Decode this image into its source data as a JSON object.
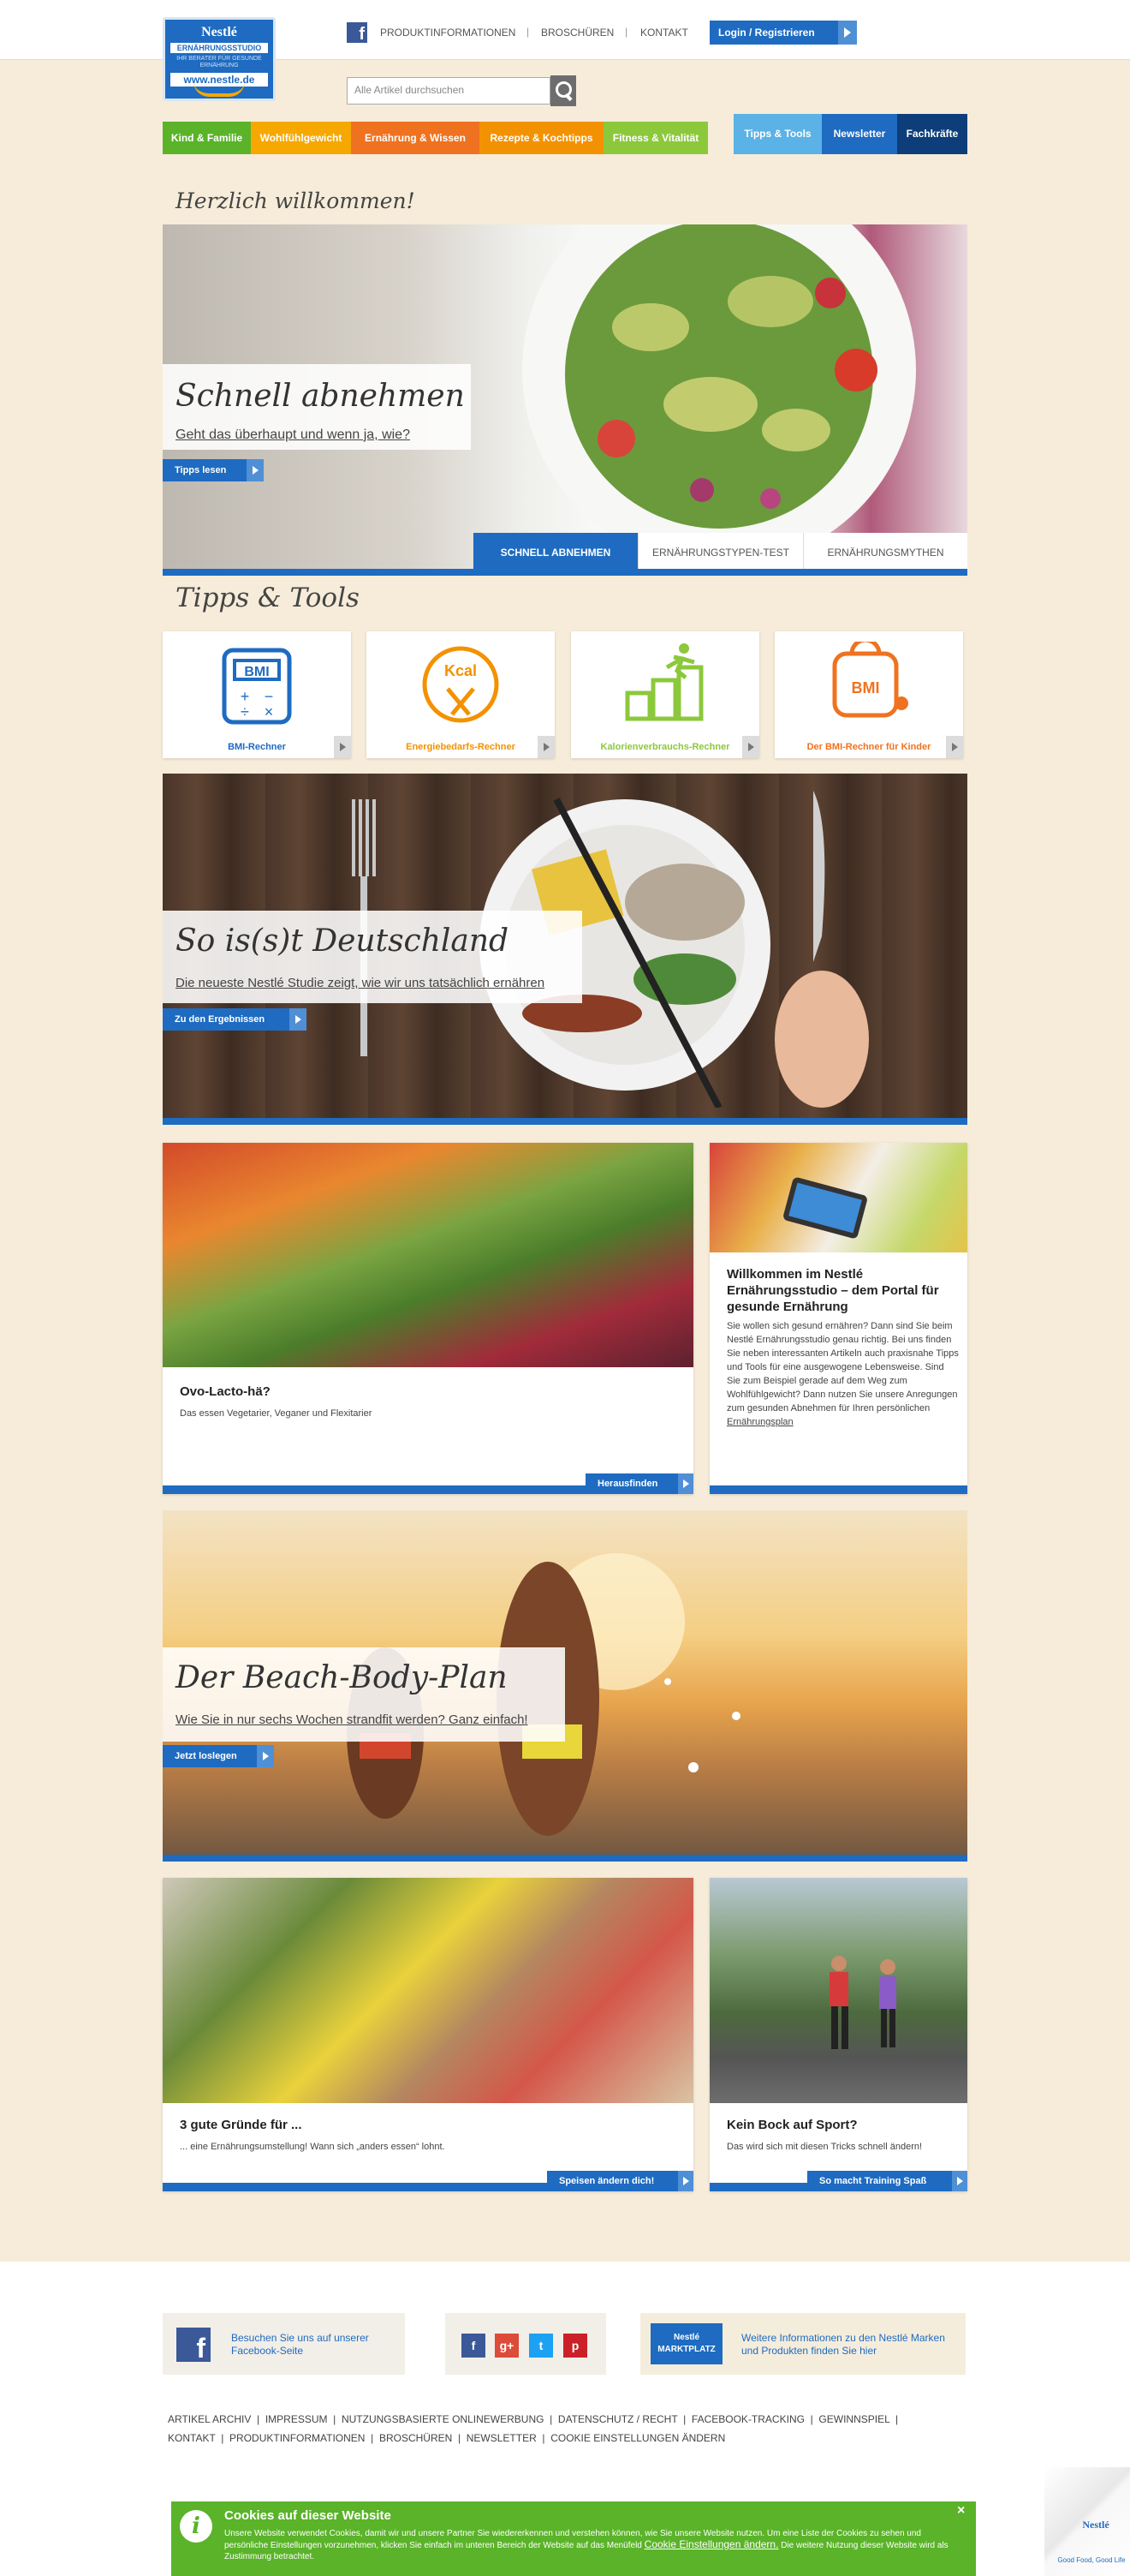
{
  "logo": {
    "brand": "Nestlé",
    "studio": "ERNÄHRUNGSSTUDIO",
    "tagline": "IHR BERATER FÜR GESUNDE ERNÄHRUNG",
    "url": "www.nestle.de"
  },
  "topnav": {
    "links": [
      "PRODUKTINFORMATIONEN",
      "BROSCHÜREN",
      "KONTAKT"
    ],
    "login": "Login / Registrieren",
    "fb": "f"
  },
  "search": {
    "placeholder": "Alle Artikel durchsuchen"
  },
  "mainnav": {
    "items": [
      {
        "label": "Kind & Familie",
        "color": "#5ab329"
      },
      {
        "label": "Wohlfühlgewicht",
        "color": "#f6a800"
      },
      {
        "label": "Ernährung & Wissen",
        "color": "#ef7220"
      },
      {
        "label": "Rezepte & Kochtipps",
        "color": "#f39200"
      },
      {
        "label": "Fitness & Vitalität",
        "color": "#8cc83c"
      }
    ],
    "right": [
      {
        "label": "Tipps & Tools",
        "color": "#5ab2e6"
      },
      {
        "label": "Newsletter",
        "color": "#1e6bc1"
      },
      {
        "label": "Fachkräfte",
        "color": "#0d3e7a"
      }
    ]
  },
  "welcome": "Herzlich willkommen!",
  "hero1": {
    "title": "Schnell abnehmen",
    "subtitle": "Geht das überhaupt und wenn ja, wie?",
    "cta": "Tipps lesen",
    "tabs": [
      "SCHNELL ABNEHMEN",
      "ERNÄHRUNGSTYPEN-TEST",
      "ERNÄHRUNGSMYTHEN"
    ]
  },
  "tipps": {
    "title": "Tipps & Tools",
    "tools": [
      {
        "label": "BMI-Rechner",
        "color": "#1e6bc1",
        "icon": "bmi-calculator-icon"
      },
      {
        "label": "Energiebedarfs-Rechner",
        "color": "#f39200",
        "icon": "kcal-plate-icon"
      },
      {
        "label": "Kalorienverbrauchs-Rechner",
        "color": "#8cc83c",
        "icon": "stairs-runner-icon"
      },
      {
        "label": "Der BMI-Rechner für Kinder",
        "color": "#ef7220",
        "icon": "bmi-scale-icon"
      }
    ]
  },
  "hero2": {
    "title": "So is(s)t Deutschland",
    "subtitle": "Die neueste Nestlé Studie zeigt, wie wir uns tatsächlich ernähren",
    "cta": "Zu den Ergebnissen"
  },
  "card1": {
    "title": "Ovo-Lacto-hä?",
    "text": "Das essen Vegetarier, Veganer und Flexitarier",
    "cta": "Herausfinden"
  },
  "portal": {
    "title": "Willkommen im Nestlé Ernährungsstudio – dem Portal für gesunde Ernährung",
    "text": "Sie wollen sich gesund ernähren? Dann sind Sie beim Nestlé Ernährungsstudio genau richtig. Bei uns finden Sie neben interessanten Artikeln auch praxisnahe Tipps und Tools für eine ausgewogene Lebensweise. Sind Sie zum Beispiel gerade auf dem Weg zum Wohlfühlgewicht? Dann nutzen Sie unsere Anregungen zum gesunden Abnehmen für Ihren persönlichen",
    "link": "Ernährungsplan"
  },
  "hero3": {
    "title": "Der Beach-Body-Plan",
    "subtitle": "Wie Sie in nur sechs Wochen strandfit werden? Ganz einfach!",
    "cta": "Jetzt loslegen"
  },
  "card2": {
    "title": "3 gute Gründe für ...",
    "text": "... eine Ernährungsumstellung! Wann sich „anders essen“ lohnt.",
    "cta": "Speisen ändern dich!"
  },
  "card3": {
    "title": "Kein Bock auf Sport?",
    "text": "Das wird sich mit diesen Tricks schnell ändern!",
    "cta": "So macht Training Spaß"
  },
  "footer": {
    "facebook": "Besuchen Sie uns auf unserer Facebook-Seite",
    "social": [
      "f",
      "g+",
      "t",
      "p"
    ],
    "marktplatz_logo": "Nestlé MARKTPLATZ",
    "marktplatz": "Weitere Informationen zu den Nestlé Marken und Produkten finden Sie hier",
    "links1": [
      "ARTIKEL ARCHIV",
      "IMPRESSUM",
      "NUTZUNGSBASIERTE ONLINEWERBUNG",
      "DATENSCHUTZ / RECHT",
      "FACEBOOK-TRACKING",
      "GEWINNSPIEL"
    ],
    "links2": [
      "KONTAKT",
      "PRODUKTINFORMATIONEN",
      "BROSCHÜREN",
      "NEWSLETTER",
      "COOKIE EINSTELLUNGEN ÄNDERN"
    ],
    "corner_brand": "Nestlé",
    "corner_tag": "Good Food, Good Life"
  },
  "cookie": {
    "title": "Cookies auf dieser Website",
    "text": "Unsere Website verwendet Cookies, damit wir und unsere Partner Sie wiedererkennen und verstehen können, wie Sie unsere Website nutzen. Um eine Liste der Cookies zu sehen und persönliche Einstellungen vorzunehmen, klicken Sie einfach im unteren Bereich der Website auf das Menüfeld",
    "link": "Cookie Einstellungen ändern.",
    "text2": "Die weitere Nutzung dieser Website wird als Zustimmung betrachtet.",
    "close": "×",
    "icon": "i"
  }
}
